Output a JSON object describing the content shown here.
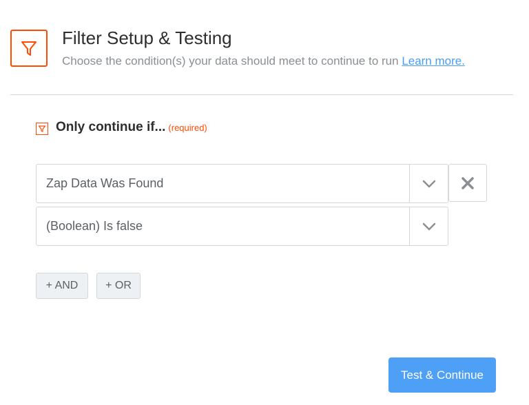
{
  "header": {
    "title": "Filter Setup & Testing",
    "subtitle": "Choose the condition(s) your data should meet to continue to run",
    "learn_more_label": "Learn more.",
    "icon": "filter-icon"
  },
  "section": {
    "heading": "Only continue if...",
    "required_label": "(required)",
    "icon": "filter-icon"
  },
  "conditions": [
    {
      "field": "Zap Data Was Found"
    },
    {
      "operator": "(Boolean) Is false"
    }
  ],
  "actions": {
    "and_label": "+ AND",
    "or_label": "+ OR",
    "submit_label": "Test & Continue"
  },
  "colors": {
    "accent": "#ff4a00",
    "primary": "#4da0f5",
    "link": "#499df3"
  }
}
